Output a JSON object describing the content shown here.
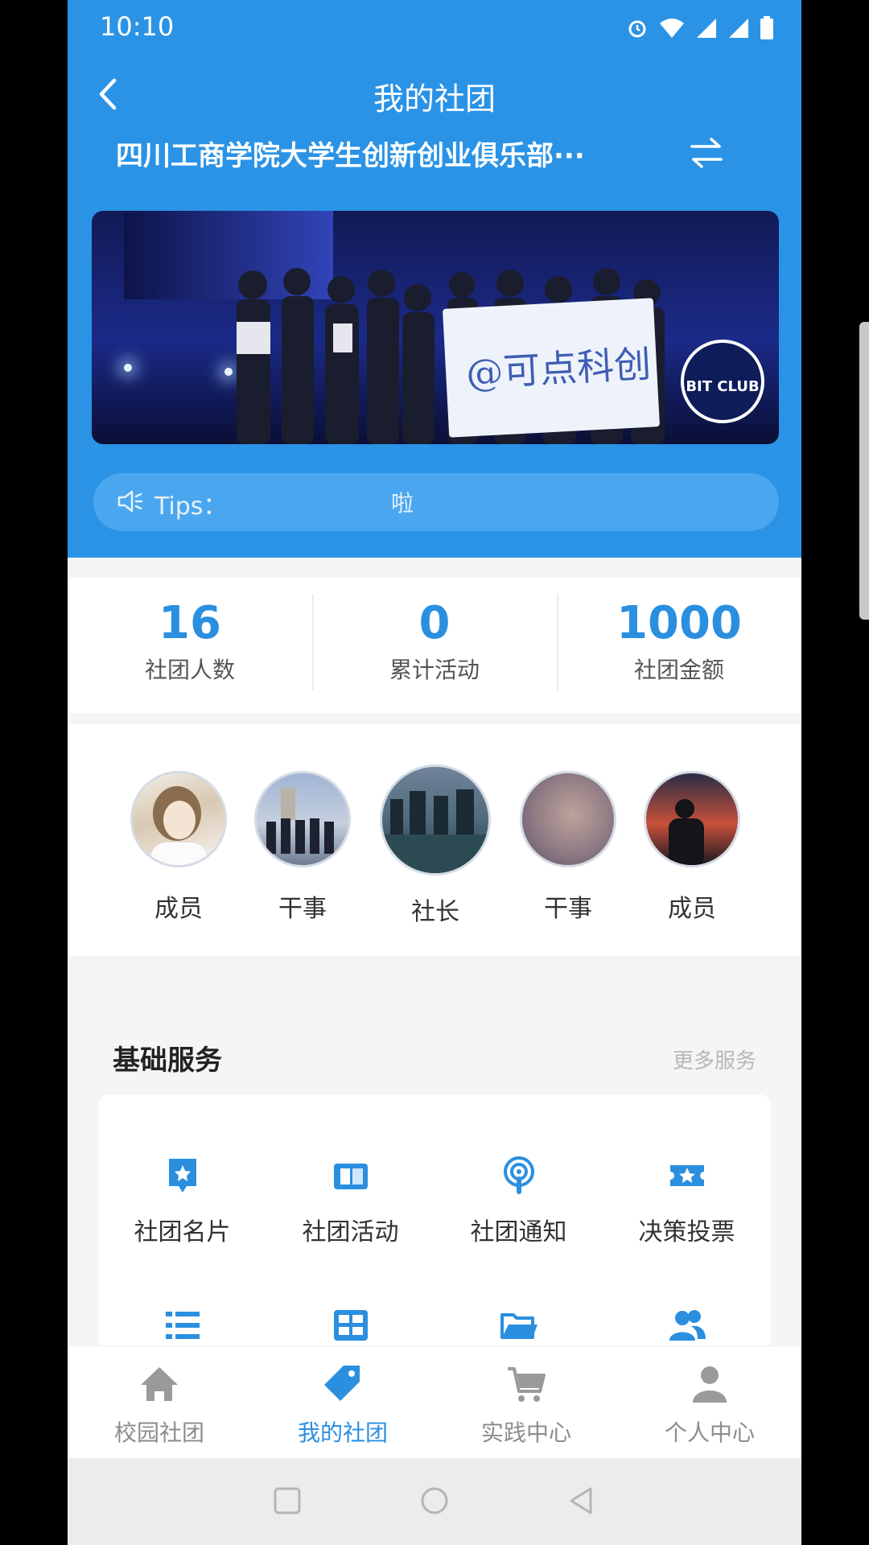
{
  "status": {
    "time": "10:10"
  },
  "nav": {
    "title": "我的社团"
  },
  "club": {
    "name": "四川工商学院大学生创新创业俱乐部···"
  },
  "banner": {
    "flag_text": "@可点科创",
    "logo_text": "BIT CLUB"
  },
  "tips": {
    "label": "Tips：",
    "text": "啦"
  },
  "stats": [
    {
      "value": "16",
      "label": "社团人数"
    },
    {
      "value": "0",
      "label": "累计活动"
    },
    {
      "value": "1000",
      "label": "社团金额"
    }
  ],
  "members": [
    {
      "role": "成员"
    },
    {
      "role": "干事"
    },
    {
      "role": "社长"
    },
    {
      "role": "干事"
    },
    {
      "role": "成员"
    }
  ],
  "services": {
    "title": "基础服务",
    "more": "更多服务",
    "items": [
      {
        "label": "社团名片",
        "icon": "card-icon"
      },
      {
        "label": "社团活动",
        "icon": "book-icon"
      },
      {
        "label": "社团通知",
        "icon": "broadcast-icon"
      },
      {
        "label": "决策投票",
        "icon": "ticket-icon"
      },
      {
        "label": "",
        "icon": "list-icon"
      },
      {
        "label": "",
        "icon": "grid-icon"
      },
      {
        "label": "",
        "icon": "folder-icon"
      },
      {
        "label": "",
        "icon": "users-icon"
      }
    ]
  },
  "tabs": [
    {
      "label": "校园社团",
      "icon": "home-icon",
      "active": false
    },
    {
      "label": "我的社团",
      "icon": "tag-icon",
      "active": true
    },
    {
      "label": "实践中心",
      "icon": "cart-icon",
      "active": false
    },
    {
      "label": "个人中心",
      "icon": "person-icon",
      "active": false
    }
  ],
  "colors": {
    "primary": "#2b93e6",
    "accent": "#2b8fe0",
    "tab_inactive": "#8c8c8c"
  }
}
